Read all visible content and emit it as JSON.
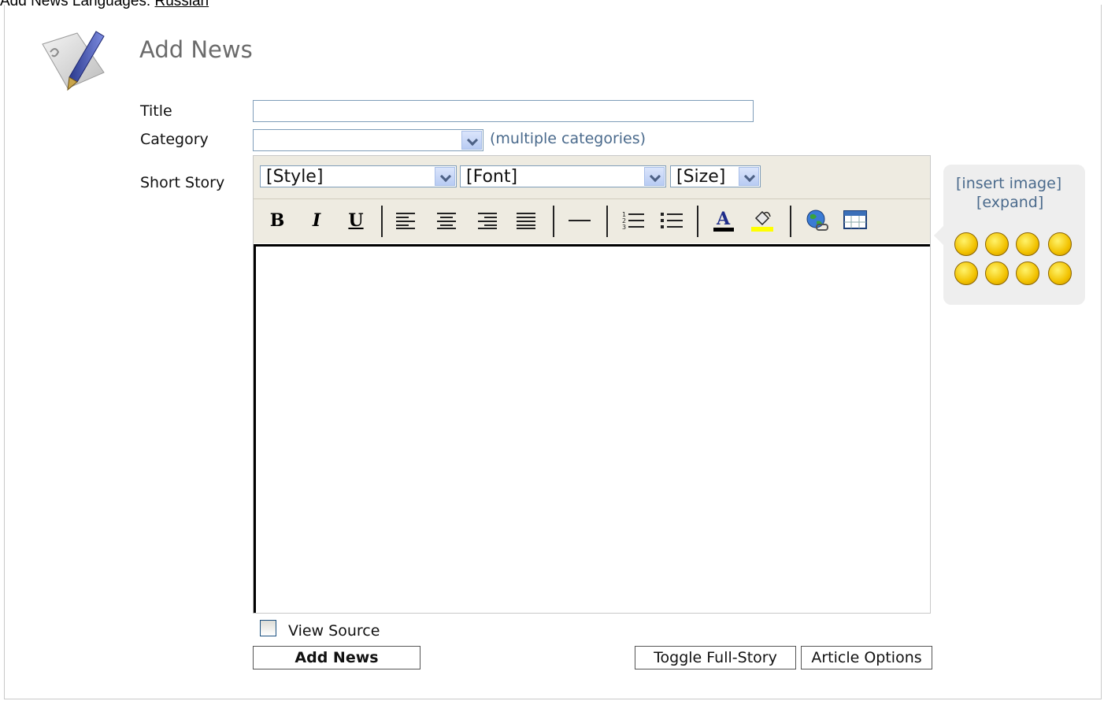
{
  "topline": {
    "prefix": "Add News    Languages: ",
    "link": "Russian"
  },
  "page": {
    "title": "Add News"
  },
  "form": {
    "title_label": "Title",
    "title_value": "",
    "category_label": "Category",
    "category_selected": "",
    "multiple_categories_link": "(multiple categories)",
    "short_story_label": "Short Story"
  },
  "toolbar": {
    "style_select": "[Style]",
    "font_select": "[Font]",
    "size_select": "[Size]",
    "bold": "B",
    "italic": "I",
    "underline": "U"
  },
  "side": {
    "insert_image": "[insert image]",
    "expand": "[expand]",
    "smileys": [
      "smile",
      "wink",
      "tongue",
      "joyful",
      "laughing",
      "sad",
      "angry",
      "shocked"
    ]
  },
  "bottom": {
    "view_source": "View Source",
    "add_news_button": "Add News",
    "toggle_full_story": "Toggle Full-Story",
    "article_options": "Article Options"
  }
}
